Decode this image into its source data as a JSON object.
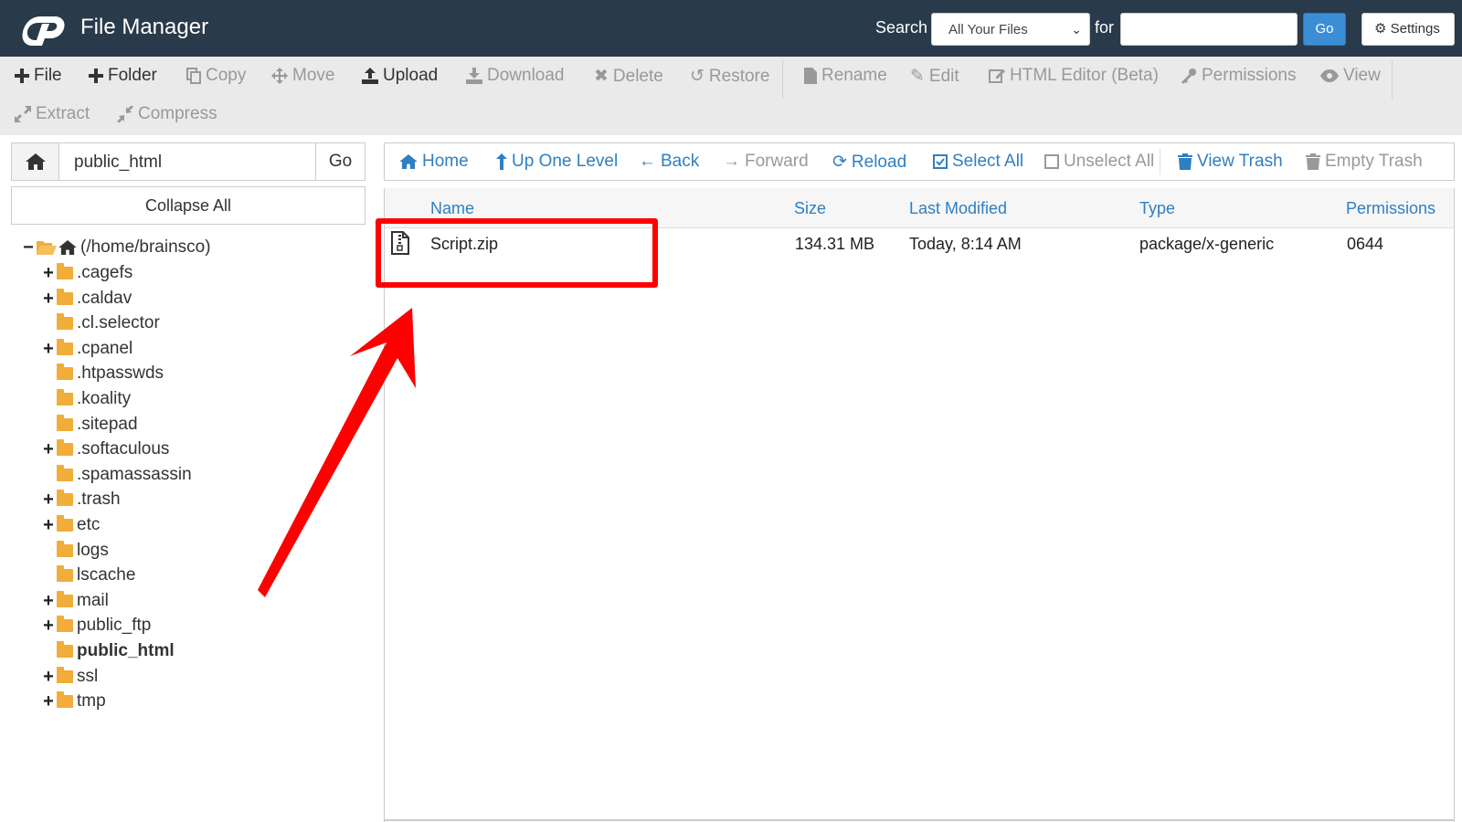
{
  "header": {
    "app_title": "File Manager",
    "search_label": "Search",
    "search_scope": "All Your Files",
    "for_label": "for",
    "search_value": "",
    "go_label": "Go",
    "settings_label": "Settings"
  },
  "toolbar": {
    "file": "File",
    "folder": "Folder",
    "copy": "Copy",
    "move": "Move",
    "upload": "Upload",
    "download": "Download",
    "delete": "Delete",
    "restore": "Restore",
    "rename": "Rename",
    "edit": "Edit",
    "html_editor": "HTML Editor (Beta)",
    "permissions": "Permissions",
    "view": "View",
    "extract": "Extract",
    "compress": "Compress"
  },
  "left": {
    "path_value": "public_html",
    "go_label": "Go",
    "collapse_all": "Collapse All",
    "root": "(/home/brainsco)",
    "tree": [
      {
        "label": ".cagefs",
        "expandable": true
      },
      {
        "label": ".caldav",
        "expandable": true
      },
      {
        "label": ".cl.selector",
        "expandable": false
      },
      {
        "label": ".cpanel",
        "expandable": true
      },
      {
        "label": ".htpasswds",
        "expandable": false
      },
      {
        "label": ".koality",
        "expandable": false
      },
      {
        "label": ".sitepad",
        "expandable": false
      },
      {
        "label": ".softaculous",
        "expandable": true
      },
      {
        "label": ".spamassassin",
        "expandable": false
      },
      {
        "label": ".trash",
        "expandable": true
      },
      {
        "label": "etc",
        "expandable": true
      },
      {
        "label": "logs",
        "expandable": false
      },
      {
        "label": "lscache",
        "expandable": false
      },
      {
        "label": "mail",
        "expandable": true
      },
      {
        "label": "public_ftp",
        "expandable": true
      },
      {
        "label": "public_html",
        "expandable": false,
        "current": true
      },
      {
        "label": "ssl",
        "expandable": true
      },
      {
        "label": "tmp",
        "expandable": true
      }
    ]
  },
  "nav": {
    "home": "Home",
    "up_one_level": "Up One Level",
    "back": "Back",
    "forward": "Forward",
    "reload": "Reload",
    "select_all": "Select All",
    "unselect_all": "Unselect All",
    "view_trash": "View Trash",
    "empty_trash": "Empty Trash"
  },
  "table": {
    "columns": {
      "name": "Name",
      "size": "Size",
      "last_modified": "Last Modified",
      "type": "Type",
      "permissions": "Permissions"
    },
    "rows": [
      {
        "name": "Script.zip",
        "size": "134.31 MB",
        "last_modified": "Today, 8:14 AM",
        "type": "package/x-generic",
        "permissions": "0644"
      }
    ]
  },
  "colors": {
    "header_bg": "#293a4a",
    "accent_blue": "#2f7fc1",
    "go_button": "#3b8ed6",
    "annotation_red": "#ff0000",
    "folder_orange": "#f0ad3a"
  }
}
